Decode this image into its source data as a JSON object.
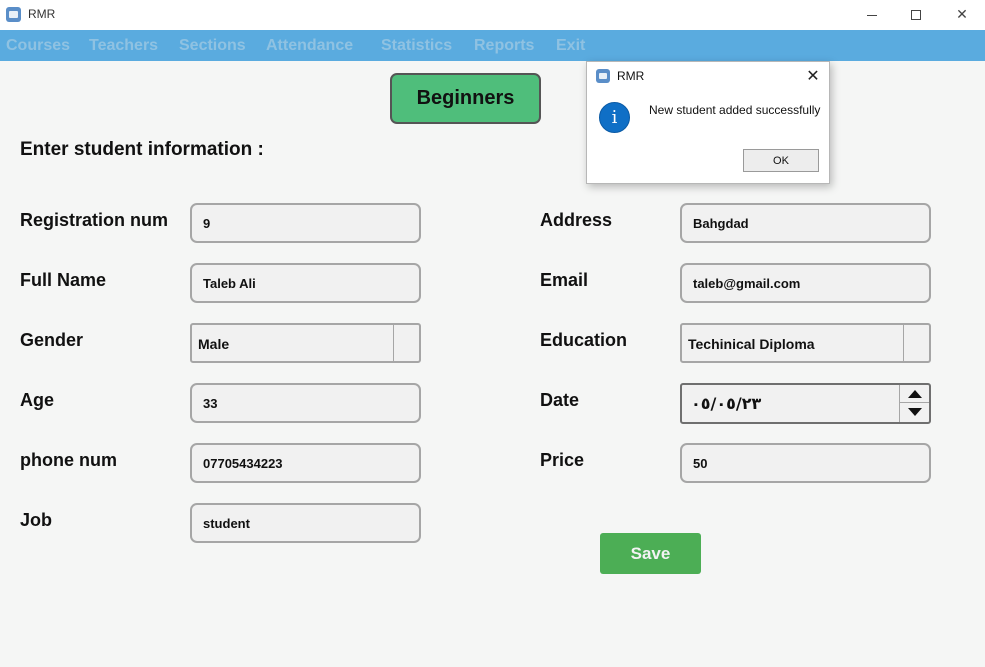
{
  "window": {
    "title": "RMR",
    "minimize_glyph": "",
    "close_glyph": "✕"
  },
  "menu": {
    "items": [
      "Courses",
      "Teachers",
      "Sections",
      "Attendance",
      "Statistics",
      "Reports",
      "Exit"
    ]
  },
  "course_label": "Beginners",
  "form_title": "Enter student information :",
  "left_fields": [
    {
      "label": "Registration num",
      "value": "9"
    },
    {
      "label": "Full Name",
      "value": "Taleb Ali"
    },
    {
      "label": "Gender",
      "value": "Male"
    },
    {
      "label": "Age",
      "value": "33"
    },
    {
      "label": "phone num",
      "value": "07705434223"
    },
    {
      "label": "Job",
      "value": "student"
    }
  ],
  "right_fields": [
    {
      "label": "Address",
      "value": "Bahgdad"
    },
    {
      "label": "Email",
      "value": "taleb@gmail.com"
    },
    {
      "label": "Education",
      "value": "Techinical Diploma"
    },
    {
      "label": "Date",
      "value": "٠٥/٠٥/٢٣"
    },
    {
      "label": "Price",
      "value": "50"
    }
  ],
  "save_label": "Save",
  "dialog": {
    "title": "RMR",
    "info_glyph": "i",
    "close_glyph": "✕",
    "message": "New student added successfully",
    "ok_label": "OK"
  },
  "colors": {
    "menubar": "#5aabdf",
    "course_box": "#4fbe7b",
    "save_button": "#4cae55",
    "info_icon": "#0f6fc6"
  },
  "icons": {
    "app": "app-icon",
    "info": "info-icon",
    "combo_arrow": "dropdown-arrow-icon",
    "spin_up": "spin-up-arrow-icon",
    "spin_down": "spin-down-arrow-icon"
  }
}
